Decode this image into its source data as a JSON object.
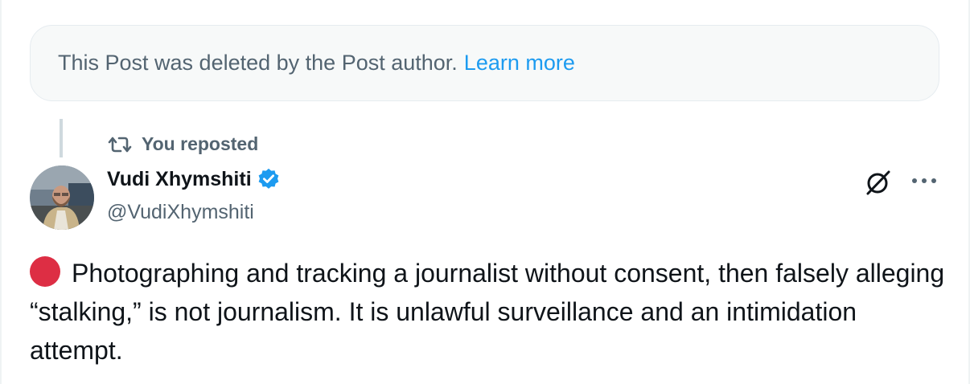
{
  "deleted_notice": {
    "text": "This Post was deleted by the Post author.",
    "link": "Learn more"
  },
  "repost": {
    "icon": "repost-icon",
    "label": "You reposted"
  },
  "author": {
    "name": "Vudi Xhymshiti",
    "handle": "@VudiXhymshiti",
    "verified": true,
    "verified_color": "#1d9bf0"
  },
  "tweet": {
    "emoji": "red-circle-icon",
    "text": "Photographing and tracking a journalist without consent, then falsely alleging “stalking,” is not journalism. It is unlawful surveillance and an intimidation attempt."
  },
  "actions": {
    "grok_icon": "grok-icon",
    "more_icon": "more-icon"
  },
  "colors": {
    "link": "#1d9bf0",
    "secondary_text": "#536471",
    "primary_text": "#0f1419",
    "notice_bg": "#f7f9f9",
    "red_dot": "#dd2e44"
  }
}
